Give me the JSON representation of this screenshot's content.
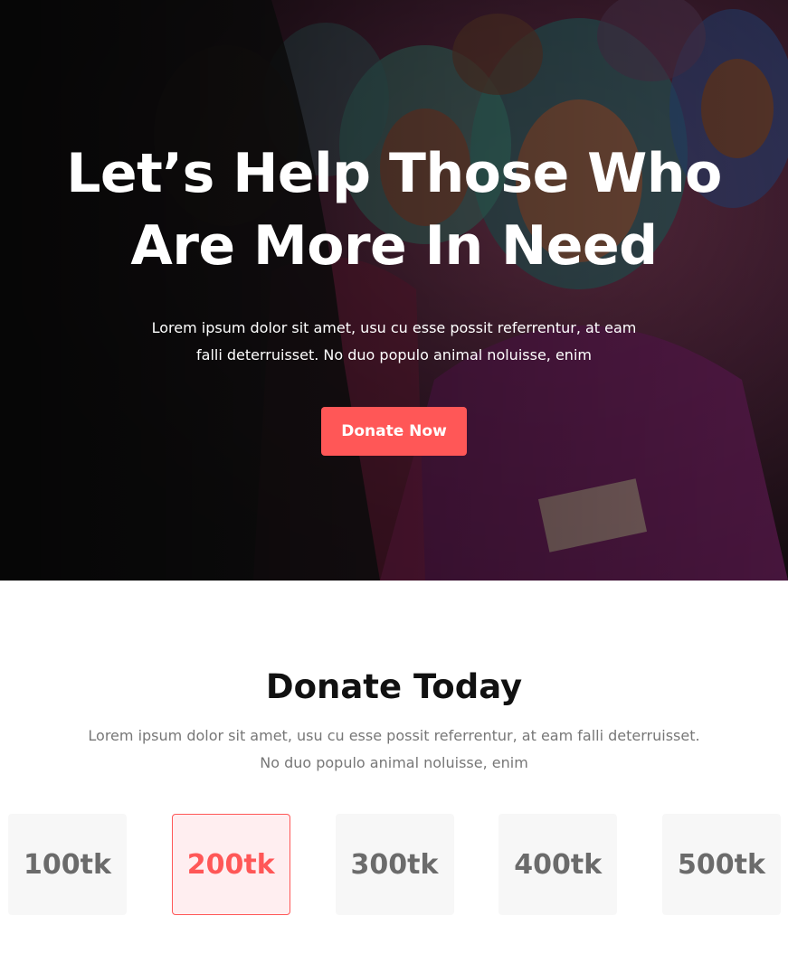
{
  "hero": {
    "title": "Let’s Help Those Who Are More In Need",
    "text": "Lorem ipsum dolor sit amet, usu cu esse possit referrentur, at eam falli deterruisset. No duo populo animal noluisse, enim",
    "button_label": "Donate Now"
  },
  "donate": {
    "title": "Donate Today",
    "text": "Lorem ipsum dolor sit amet, usu cu esse possit referrentur, at eam falli deterruisset. No duo populo animal noluisse, enim",
    "amounts": [
      {
        "label": "100tk",
        "selected": false
      },
      {
        "label": "200tk",
        "selected": true
      },
      {
        "label": "300tk",
        "selected": false
      },
      {
        "label": "400tk",
        "selected": false
      },
      {
        "label": "500tk",
        "selected": false
      }
    ]
  },
  "colors": {
    "accent": "#ff5757",
    "selected_bg": "#ffeef0",
    "card_bg": "#f7f7f7",
    "muted_text": "#777777"
  }
}
